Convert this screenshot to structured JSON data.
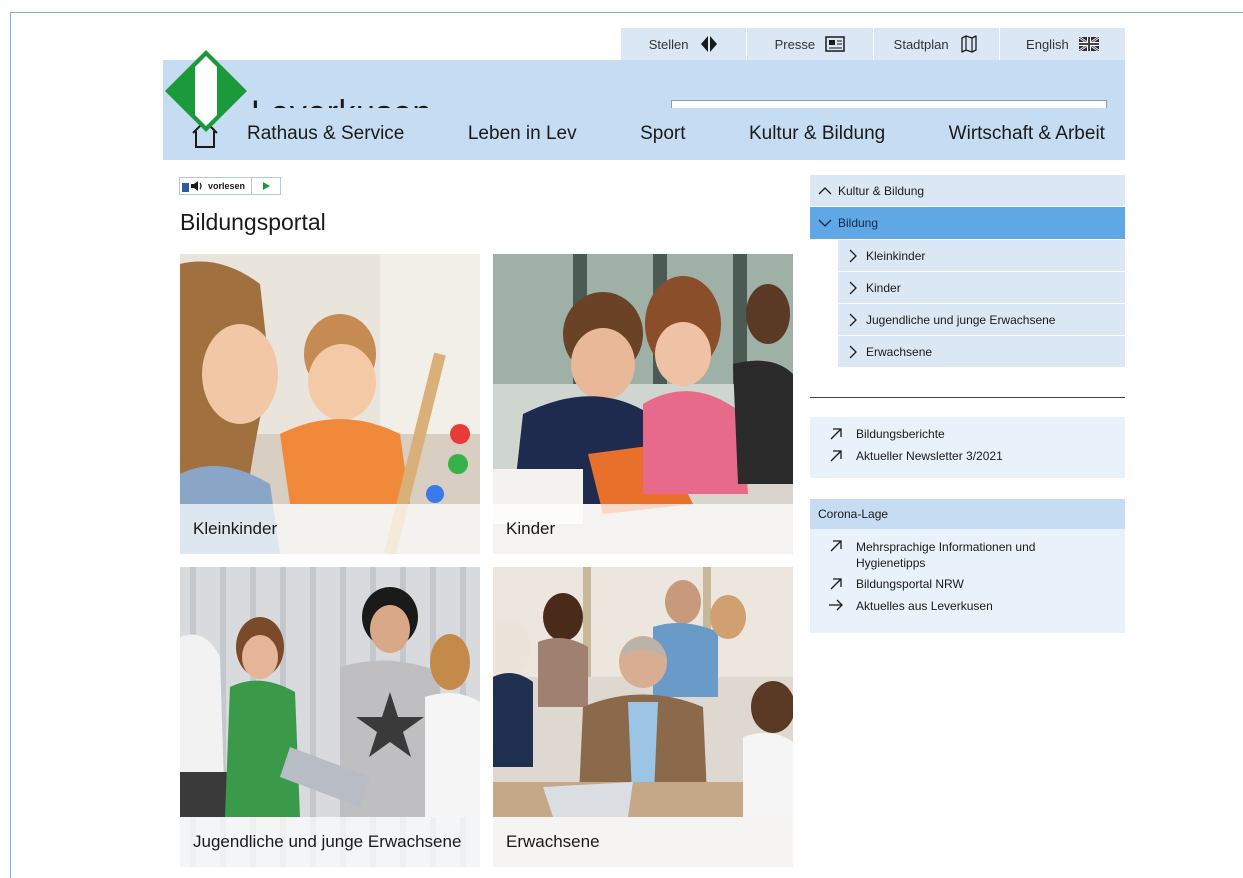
{
  "header": {
    "site_title": "Leverkusen",
    "utility": [
      {
        "label": "Stellen",
        "icon": "diamond-arrows-icon"
      },
      {
        "label": "Presse",
        "icon": "newspaper-icon"
      },
      {
        "label": "Stadtplan",
        "icon": "map-icon"
      },
      {
        "label": "English",
        "icon": "uk-flag-icon"
      }
    ],
    "search": {
      "value": "",
      "placeholder": ""
    },
    "nav": [
      {
        "label": "Rathaus & Service"
      },
      {
        "label": "Leben in Lev"
      },
      {
        "label": "Sport"
      },
      {
        "label": "Kultur & Bildung"
      },
      {
        "label": "Wirtschaft & Arbeit"
      }
    ]
  },
  "readaloud": {
    "label": "vorlesen"
  },
  "main": {
    "title": "Bildungsportal",
    "tiles": [
      {
        "label": "Kleinkinder"
      },
      {
        "label": "Kinder"
      },
      {
        "label": "Jugendliche und junge Erwachsene"
      },
      {
        "label": "Erwachsene"
      }
    ]
  },
  "sidebar": {
    "parent": "Kultur & Bildung",
    "active": "Bildung",
    "subitems": [
      {
        "label": "Kleinkinder"
      },
      {
        "label": "Kinder"
      },
      {
        "label": "Jugendliche und junge Erwachsene"
      },
      {
        "label": "Erwachsene"
      }
    ],
    "links": [
      {
        "label": "Bildungsberichte"
      },
      {
        "label": "Aktueller Newsletter 3/2021"
      }
    ],
    "corona": {
      "heading": "Corona-Lage",
      "links": [
        {
          "label": "Mehrsprachige Informationen und Hygienetipps"
        },
        {
          "label": "Bildungsportal NRW"
        },
        {
          "label": "Aktuelles aus Leverkusen"
        }
      ]
    }
  },
  "colors": {
    "header_band": "#c6dcf3",
    "utility_bar": "#dbe7f5",
    "active_nav": "#5fa7e5",
    "logo_green": "#1a9a3a"
  }
}
